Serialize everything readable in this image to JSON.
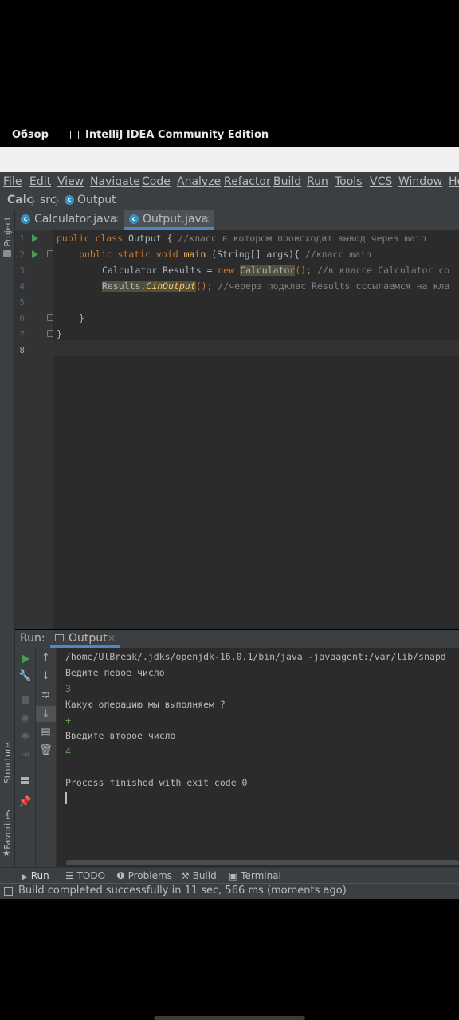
{
  "system_bar": {
    "overview": "Обзор",
    "app_title": "IntelliJ IDEA Community Edition"
  },
  "menu": [
    "File",
    "Edit",
    "View",
    "Navigate",
    "Code",
    "Analyze",
    "Refactor",
    "Build",
    "Run",
    "Tools",
    "VCS",
    "Window",
    "He"
  ],
  "breadcrumb": {
    "project": "Calc",
    "folder": "src",
    "file": "Output"
  },
  "side_panels": {
    "project": "Project",
    "structure": "Structure",
    "favorites": "Favorites"
  },
  "tabs": [
    {
      "label": "Calculator.java",
      "icon": "c",
      "active": false
    },
    {
      "label": "Output.java",
      "icon": "c",
      "active": true
    }
  ],
  "editor": {
    "line_numbers": [
      "1",
      "2",
      "3",
      "4",
      "5",
      "6",
      "7",
      "8"
    ],
    "lines": [
      {
        "kw1": "public class ",
        "t1": "Output { ",
        "c1": "//класс в котором происходит вывод через main"
      },
      {
        "kw1": "public static void ",
        "fn": "main",
        "t1": " (String[] args){ ",
        "c1": "//класс main"
      },
      {
        "t1": "Calculator Results = ",
        "kw1": "new ",
        "hl": "Calculator",
        "t2": "(); ",
        "c1": "//в классе Calculator со"
      },
      {
        "hl": "Results.",
        "it": "CinOutput",
        "t2": "(); ",
        "c1": "//черерз подклас Results сссылаемся на кла"
      },
      {
        "t1": ""
      },
      {
        "t1": "}"
      },
      {
        "t1": "}"
      },
      {
        "t1": ""
      }
    ]
  },
  "run_panel": {
    "label": "Run:",
    "tab": "Output",
    "console": [
      {
        "text": "/home/UlBreak/.jdks/openjdk-16.0.1/bin/java -javaagent:/var/lib/snapd",
        "kind": "out"
      },
      {
        "text": "Ведите певое число",
        "kind": "out"
      },
      {
        "text": "3",
        "kind": "in"
      },
      {
        "text": "Какую операцию мы выполняем ?",
        "kind": "out"
      },
      {
        "text": "+",
        "kind": "in"
      },
      {
        "text": "Введите второе число",
        "kind": "out"
      },
      {
        "text": "4",
        "kind": "in"
      },
      {
        "text": "",
        "kind": "out"
      },
      {
        "text": "Process finished with exit code 0",
        "kind": "out"
      }
    ]
  },
  "bottom_tabs": [
    "Run",
    "TODO",
    "Problems",
    "Build",
    "Terminal"
  ],
  "status": "Build completed successfully in 11 sec, 566 ms (moments ago)",
  "colors": {
    "keyword": "#cc7832",
    "comment": "#808080",
    "method": "#ffc66d",
    "run_green": "#499c54",
    "input_green": "#62a24f",
    "accent": "#4a88c7"
  }
}
